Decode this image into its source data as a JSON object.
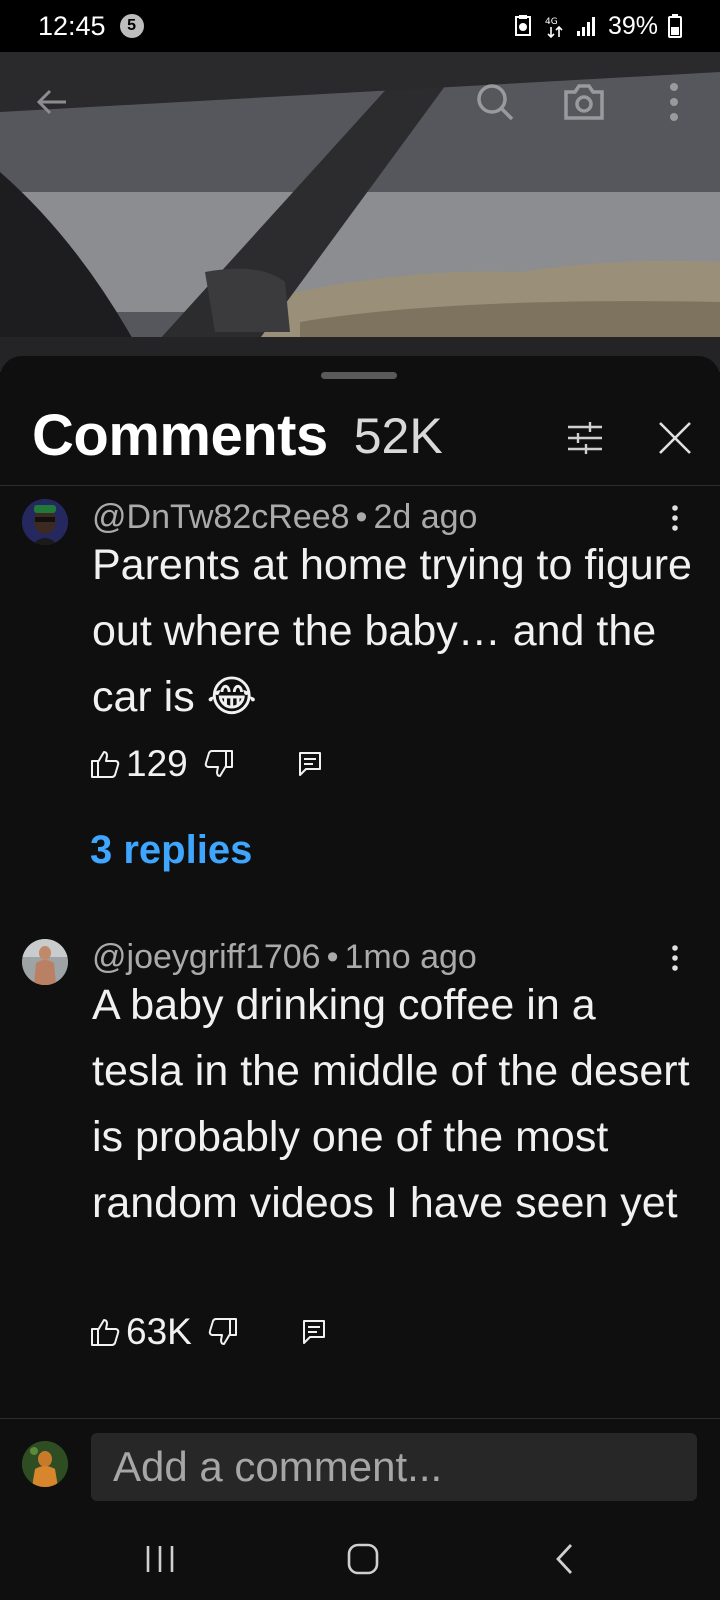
{
  "status_bar": {
    "time": "12:45",
    "notification_count": "5",
    "battery": "39%"
  },
  "header": {
    "title": "Comments",
    "count": "52K"
  },
  "comments": [
    {
      "author": "@DnTw82cRee8",
      "age": "2d ago",
      "text": "Parents at home trying to figure out where the baby… and the car is 😂",
      "likes": "129",
      "replies_label": "3 replies"
    },
    {
      "author": "@joeygriff1706",
      "age": "1mo ago",
      "text": "A baby drinking coffee in a tesla in the middle of the desert is probably one of the most random videos I have seen yet",
      "likes": "63K"
    }
  ],
  "composer": {
    "placeholder": "Add a comment..."
  },
  "colors": {
    "background": "#0f0f0f",
    "link": "#3ea6ff",
    "secondary_text": "#aaaaaa"
  },
  "icons": {
    "video": [
      "back-arrow-icon",
      "search-icon",
      "camera-icon",
      "more-vert-icon"
    ],
    "header": [
      "filter-sliders-icon",
      "close-icon"
    ],
    "actions": [
      "thumbs-up-icon",
      "thumbs-down-icon",
      "reply-comment-icon"
    ],
    "nav": [
      "recents-icon",
      "home-icon",
      "back-icon"
    ]
  }
}
